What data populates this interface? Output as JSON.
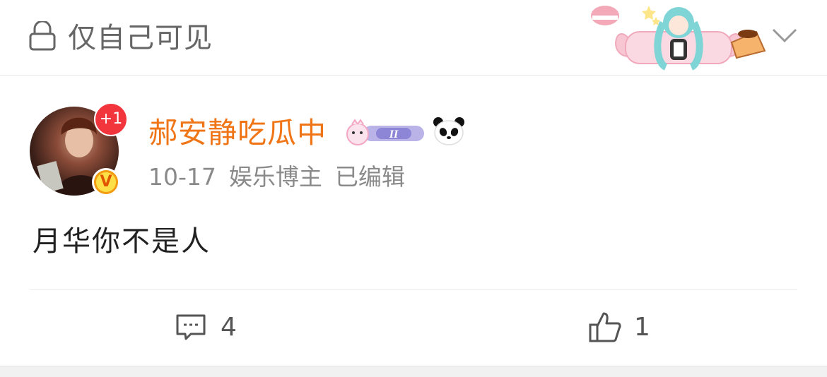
{
  "header": {
    "privacy_label": "仅自己可见"
  },
  "post": {
    "username": "郝安静吃瓜中",
    "new_count_badge": "+1",
    "rank_label": "II",
    "date": "10-17",
    "role": "娱乐博主",
    "edited": "已编辑",
    "content": "月华你不是人"
  },
  "actions": {
    "comment_count": "4",
    "like_count": "1"
  },
  "colors": {
    "username": "#f07517",
    "badge_red": "#f2343c",
    "verified_gold": "#f39c12"
  }
}
